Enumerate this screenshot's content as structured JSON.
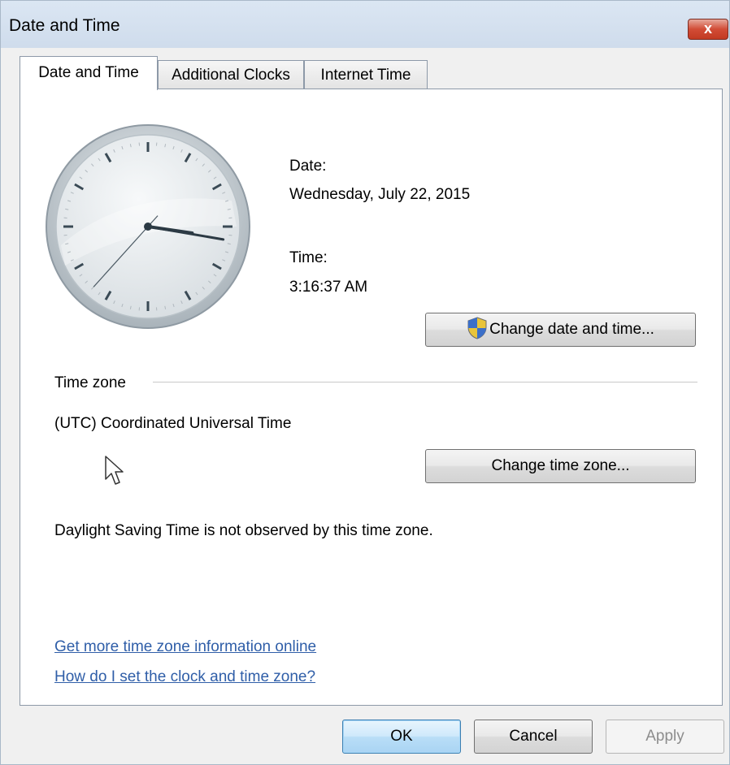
{
  "window": {
    "title": "Date and Time",
    "close_label": "x"
  },
  "tabs": [
    {
      "label": "Date and Time",
      "active": true
    },
    {
      "label": "Additional Clocks",
      "active": false
    },
    {
      "label": "Internet Time",
      "active": false
    }
  ],
  "clock": {
    "hour": 3,
    "minute": 16,
    "second": 37
  },
  "datetime": {
    "date_label": "Date:",
    "date_value": "Wednesday, July 22, 2015",
    "time_label": "Time:",
    "time_value": "3:16:37 AM",
    "change_button": "Change date and time..."
  },
  "timezone": {
    "heading": "Time zone",
    "value": "(UTC) Coordinated Universal Time",
    "change_button": "Change time zone...",
    "dst_note": "Daylight Saving Time is not observed by this time zone."
  },
  "links": [
    "Get more time zone information online",
    "How do I set the clock and time zone?"
  ],
  "footer": {
    "ok": "OK",
    "cancel": "Cancel",
    "apply": "Apply"
  },
  "icons": {
    "shield": "uac-shield-icon",
    "cursor": "mouse-pointer-icon"
  }
}
